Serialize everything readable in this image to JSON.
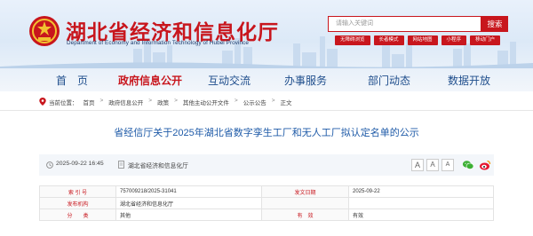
{
  "header": {
    "site_title": "湖北省经济和信息化厅",
    "site_subtitle": "Department of Economy and Information Technology of Hubei Province",
    "search_placeholder": "请输入关键词",
    "search_button": "搜索",
    "quick_links": [
      "无障碍浏览",
      "长者模式",
      "网站地图",
      "小程序",
      "移动门户"
    ]
  },
  "nav": {
    "items": [
      "首　页",
      "政府信息公开",
      "互动交流",
      "办事服务",
      "部门动态",
      "数据开放"
    ],
    "active_index": 1
  },
  "breadcrumb": {
    "prefix": "当前位置：",
    "items": [
      "首页",
      "政府信息公开",
      "政策",
      "其他主动公开文件",
      "公示公告",
      "正文"
    ],
    "separator": ">"
  },
  "article": {
    "title": "省经信厅关于2025年湖北省数字孪生工厂和无人工厂拟认定名单的公示",
    "date": "2025-09-22 16:45",
    "source": "湖北省经济和信息化厅",
    "font_sizes": [
      "A",
      "A",
      "A"
    ]
  },
  "info_table": {
    "rows": [
      {
        "label1": "索 引 号",
        "value1": "757009218/2025-31041",
        "label2": "发文日期",
        "value2": "2025-09-22"
      },
      {
        "label1": "发布机构",
        "value1": "湖北省经济和信息化厅",
        "label2": "",
        "value2": ""
      },
      {
        "label1": "分　　类",
        "value1": "其他",
        "label2": "有　效",
        "value2": "有效"
      }
    ]
  },
  "colors": {
    "brand_red": "#c8161d",
    "nav_blue": "#1f4e8c",
    "title_blue": "#1f5ba8"
  }
}
